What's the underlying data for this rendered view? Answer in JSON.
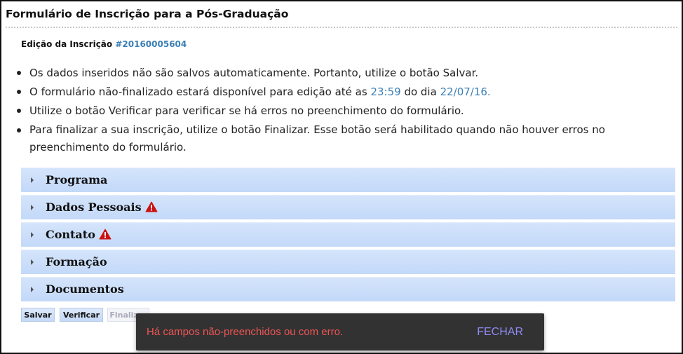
{
  "page": {
    "title": "Formulário de Inscrição para a Pós-Graduação",
    "edit_label": "Edição da Inscrição",
    "registration_number": "#20160005604"
  },
  "info": {
    "item1": "Os dados inseridos não são salvos automaticamente. Portanto, utilize o botão Salvar.",
    "item2_pre": "O formulário não-finalizado estará disponível para edição até as ",
    "item2_time": "23:59",
    "item2_mid": " do dia ",
    "item2_date": "22/07/16.",
    "item3": "Utilize o botão Verificar para verificar se há erros no preenchimento do formulário.",
    "item4_line1": "Para finalizar a sua inscrição, utilize o botão Finalizar. Esse botão será habilitado quando não houver erros no",
    "item4_line2": "preenchimento do formulário."
  },
  "sections": [
    {
      "label": "Programa",
      "warning": false
    },
    {
      "label": "Dados Pessoais",
      "warning": true
    },
    {
      "label": "Contato",
      "warning": true
    },
    {
      "label": "Formação",
      "warning": false
    },
    {
      "label": "Documentos",
      "warning": false
    }
  ],
  "buttons": {
    "save": "Salvar",
    "verify": "Verificar",
    "finish": "Finalizar",
    "finish_disabled": true
  },
  "snackbar": {
    "message": "Há campos não-preenchidos ou com erro.",
    "action": "FECHAR"
  },
  "colors": {
    "link": "#3a7fb5",
    "section_bg": "#c3d9f9",
    "warning": "#cc1111",
    "snackbar_bg": "#323232",
    "snackbar_text": "#f05555",
    "snackbar_action": "#8f8cf5"
  }
}
